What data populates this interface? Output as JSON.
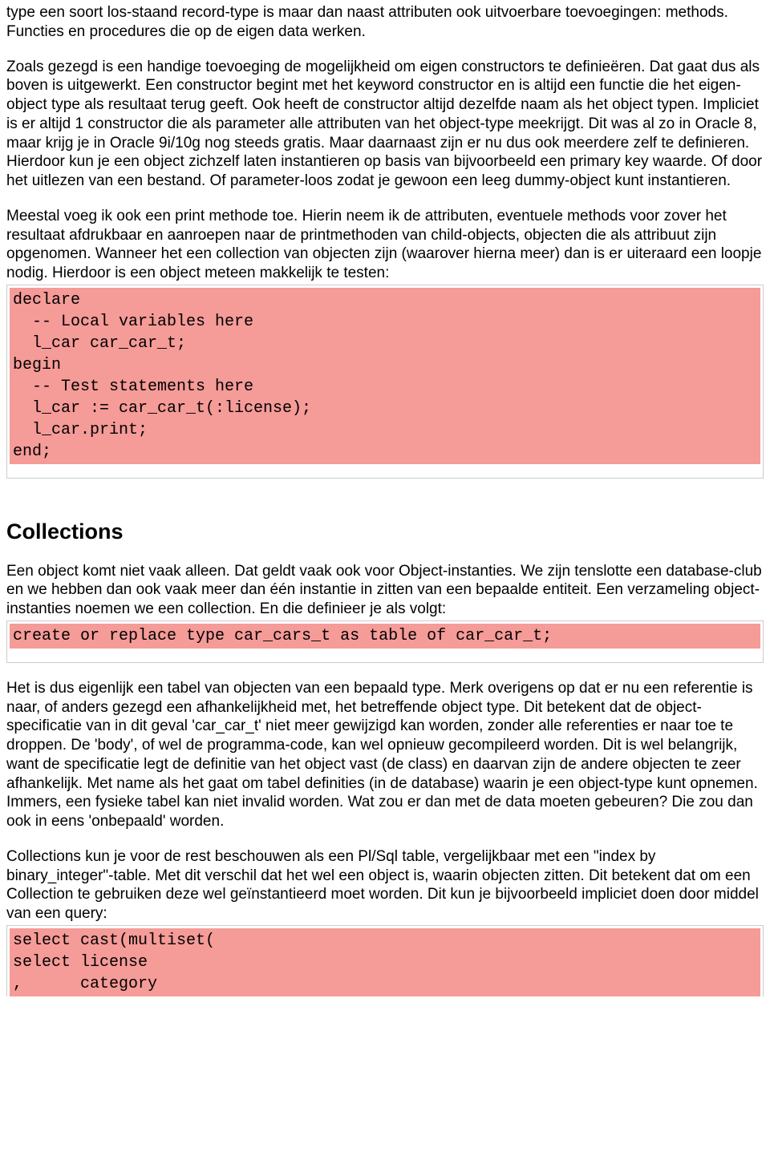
{
  "paragraphs": {
    "p1": "type een soort los-staand record-type is maar dan naast attributen ook  uitvoerbare toevoegingen: methods. Functies en procedures die op de eigen data werken.",
    "p2": "Zoals gezegd is een handige toevoeging de mogelijkheid om eigen constructors te definieëren. Dat gaat dus als boven is uitgewerkt. Een constructor begint met het keyword constructor en is altijd een functie die het eigen-object type als resultaat terug geeft. Ook heeft de constructor altijd dezelfde naam als het object typen. Impliciet is er altijd 1 constructor die als parameter alle attributen van het object-type meekrijgt. Dit was al zo in Oracle 8, maar krijg je in Oracle 9i/10g nog steeds gratis. Maar daarnaast zijn er nu dus ook meerdere zelf te definieren.  Hierdoor kun je een object zichzelf laten instantieren op basis van bijvoorbeeld een primary key waarde. Of door het uitlezen van een bestand. Of parameter-loos zodat je gewoon een leeg dummy-object kunt instantieren.",
    "p3": "Meestal voeg ik ook een print methode toe. Hierin neem ik de attributen, eventuele methods voor zover het resultaat afdrukbaar en aanroepen naar de printmethoden van child-objects, objecten die als attribuut zijn opgenomen. Wanneer het een collection van objecten zijn (waarover hierna meer) dan is er uiteraard een loopje nodig. Hierdoor is een object meteen makkelijk te testen:",
    "p4": "Een object komt niet vaak alleen. Dat geldt vaak ook voor Object-instanties. We zijn tenslotte een database-club en  we hebben dan ook vaak meer dan één instantie in zitten van een bepaalde entiteit. Een verzameling object-instanties noemen we een collection. En die definieer je als volgt:",
    "p5": "Het is dus eigenlijk een tabel van objecten van een bepaald type. Merk overigens op dat er nu een referentie is naar, of anders gezegd een afhankelijkheid met, het betreffende object type. Dit betekent dat de object-specificatie van in dit geval 'car_car_t' niet meer gewijzigd kan worden, zonder alle referenties er naar toe te droppen. De 'body', of wel de programma-code, kan wel opnieuw gecompileerd worden. Dit is wel belangrijk, want de specificatie legt de definitie van het object vast (de class) en daarvan zijn de andere objecten te zeer afhankelijk. Met name als het gaat om tabel definities (in de database) waarin je een object-type kunt opnemen. Immers, een fysieke tabel kan niet invalid worden. Wat zou er dan met de data moeten gebeuren? Die zou dan ook in eens 'onbepaald' worden.",
    "p6": "Collections kun je voor de rest beschouwen als een Pl/Sql table, vergelijkbaar met een \"index by binary_integer\"-table. Met dit verschil dat het wel een object is, waarin objecten zitten. Dit betekent dat om een Collection te gebruiken deze wel geïnstantieerd moet worden. Dit kun je bijvoorbeeld impliciet doen door middel van een query:"
  },
  "heading": "Collections",
  "code_blocks": {
    "c1": "declare\n  -- Local variables here\n  l_car car_car_t;\nbegin\n  -- Test statements here\n  l_car := car_car_t(:license);\n  l_car.print;\nend;",
    "c2": "create or replace type car_cars_t as table of car_car_t;",
    "c3": "select cast(multiset(\nselect license\n,      category"
  }
}
